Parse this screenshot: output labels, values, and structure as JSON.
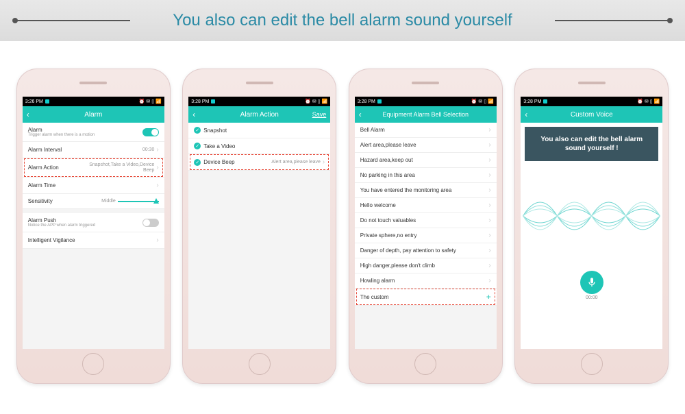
{
  "banner": {
    "text": "You also can edit the bell alarm sound yourself"
  },
  "statusbar": {
    "time1": "3:26 PM",
    "time2": "3:28 PM",
    "time3": "3:28 PM",
    "time4": "3:28 PM",
    "icons": "⏰ ✉ ▯ 📶"
  },
  "screen1": {
    "title": "Alarm",
    "r1_label": "Alarm",
    "r1_sub": "Trigger alarm when there is a motion",
    "r2_label": "Alarm Interval",
    "r2_val": "00:30",
    "r3_label": "Alarm Action",
    "r3_val": "Snapshot,Take a Video,Device Beep",
    "r4_label": "Alarm Time",
    "r5_label": "Sensitivity",
    "r5_val": "Middle",
    "r6_label": "Alarm Push",
    "r6_sub": "Notice the APP when alarm triggered",
    "r7_label": "Intelligent Vigilance"
  },
  "screen2": {
    "title": "Alarm Action",
    "save": "Save",
    "opt1": "Snapshot",
    "opt2": "Take a Video",
    "opt3": "Device Beep",
    "opt3_val": "Alert area,please leave"
  },
  "screen3": {
    "title": "Equipment Alarm Bell Selection",
    "items": [
      "Bell Alarm",
      "Alert area,please leave",
      "Hazard area,keep out",
      "No parking in this area",
      "You have entered the monitoring area",
      "Hello welcome",
      "Do not touch valuables",
      "Private sphere,no entry",
      "Danger of depth, pay attention to safety",
      "High danger,please don't climb",
      "Howling alarm",
      "The custom"
    ]
  },
  "screen4": {
    "title": "Custom Voice",
    "banner": "You also can edit the bell alarm sound yourself !",
    "time": "00:00"
  }
}
